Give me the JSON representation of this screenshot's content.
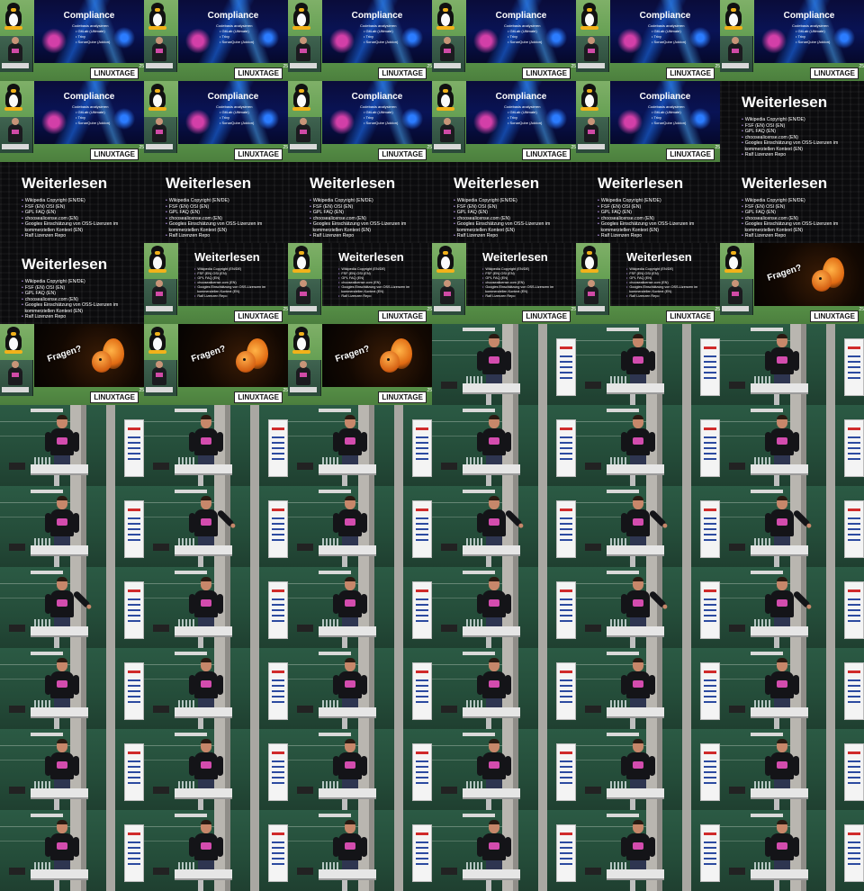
{
  "slides": {
    "compliance": {
      "title": "Compliance",
      "items": [
        {
          "text": "Codebasis analysieren",
          "sub": false
        },
        {
          "text": "GitLab (Ultimate)",
          "sub": true
        },
        {
          "text": "Trivy",
          "sub": true
        },
        {
          "text": "SonarQube (Addon)",
          "sub": true
        }
      ]
    },
    "weiterlesen": {
      "title": "Weiterlesen",
      "items": [
        "Wikipedia Copyright (EN/DE)",
        "FSF (EN) OSI (EN)",
        "GPL FAQ (EN)",
        "choosealicense.com (EN)",
        "Googles Einschätzung von OSS-Lizenzen im",
        "kommerziellen Kontext (EN)",
        "Ralf Lizenzen Repo"
      ]
    },
    "fragen": {
      "label": "Fragen?"
    }
  },
  "badge": {
    "label": "LINUXTAGE",
    "number": "25"
  },
  "tiles": [
    "compliance",
    "compliance",
    "compliance",
    "compliance",
    "compliance",
    "compliance",
    "compliance",
    "compliance",
    "compliance",
    "compliance",
    "compliance",
    "weiterlesen-full",
    "weiterlesen-full",
    "weiterlesen-full",
    "weiterlesen-full",
    "weiterlesen-full",
    "weiterlesen-full",
    "weiterlesen-full",
    "weiterlesen-full",
    "weiterlesen-framed",
    "weiterlesen-framed",
    "weiterlesen-framed",
    "weiterlesen-framed",
    "fragen",
    "fragen",
    "fragen",
    "fragen",
    "stage",
    "stage",
    "stage",
    "stage",
    "stage",
    "stage",
    "stage",
    "stage",
    "stage",
    "stage",
    "stage-gesture",
    "stage",
    "stage-gesture",
    "stage-gesture",
    "stage-gesture",
    "stage-gesture",
    "stage",
    "stage",
    "stage",
    "stage-gesture",
    "stage-gesture",
    "stage",
    "stage",
    "stage",
    "stage",
    "stage",
    "stage",
    "stage",
    "stage",
    "stage",
    "stage",
    "stage",
    "stage",
    "stage",
    "stage",
    "stage",
    "stage",
    "stage",
    "stage"
  ]
}
